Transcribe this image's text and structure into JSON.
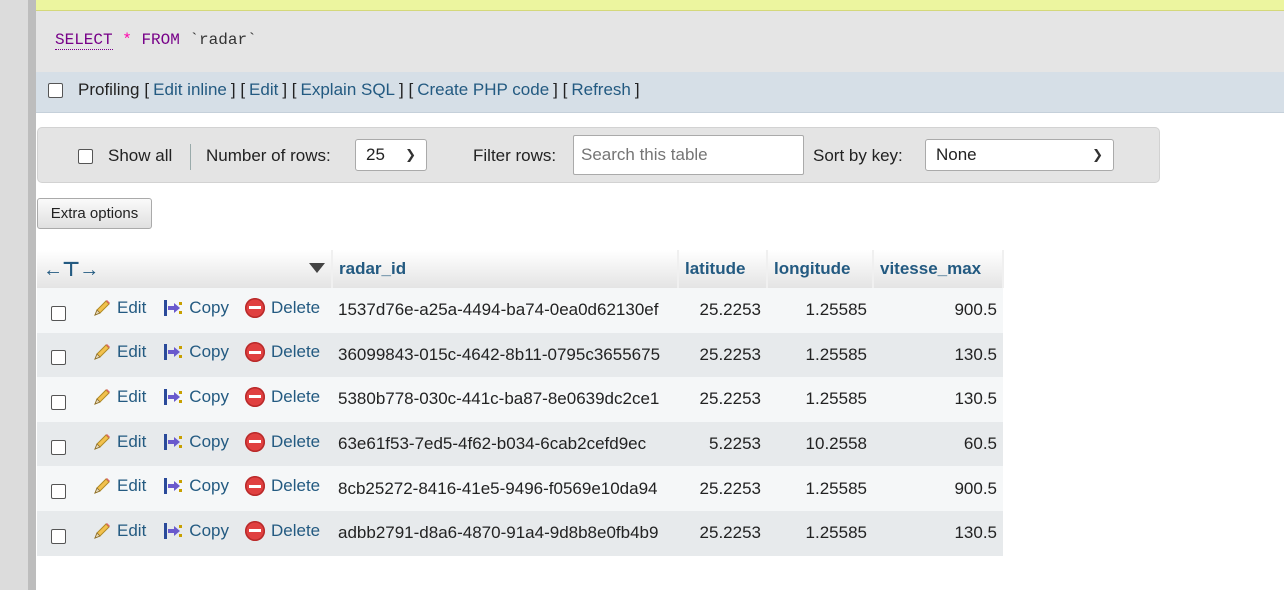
{
  "sql": {
    "select": "SELECT",
    "star": "*",
    "from": "FROM",
    "table": "`radar`"
  },
  "profiling": {
    "label": "Profiling",
    "links": [
      "Edit inline",
      "Edit",
      "Explain SQL",
      "Create PHP code",
      "Refresh"
    ]
  },
  "nav": {
    "show_all": "Show all",
    "num_rows_label": "Number of rows:",
    "num_rows_value": "25",
    "filter_label": "Filter rows:",
    "filter_placeholder": "Search this table",
    "sort_label": "Sort by key:",
    "sort_value": "None"
  },
  "extra_options": "Extra options",
  "table": {
    "columns": [
      "radar_id",
      "latitude",
      "longitude",
      "vitesse_max"
    ],
    "actions": {
      "edit": "Edit",
      "copy": "Copy",
      "delete": "Delete"
    },
    "rows": [
      [
        "1537d76e-a25a-4494-ba74-0ea0d62130ef",
        "25.2253",
        "1.25585",
        "900.5"
      ],
      [
        "36099843-015c-4642-8b11-0795c3655675",
        "25.2253",
        "1.25585",
        "130.5"
      ],
      [
        "5380b778-030c-441c-ba87-8e0639dc2ce1",
        "25.2253",
        "1.25585",
        "130.5"
      ],
      [
        "63e61f53-7ed5-4f62-b034-6cab2cefd9ec",
        "5.2253",
        "10.2558",
        "60.5"
      ],
      [
        "8cb25272-8416-41e5-9496-f0569e10da94",
        "25.2253",
        "1.25585",
        "900.5"
      ],
      [
        "adbb2791-d8a6-4870-91a4-9d8b8e0fb4b9",
        "25.2253",
        "1.25585",
        "130.5"
      ]
    ]
  }
}
